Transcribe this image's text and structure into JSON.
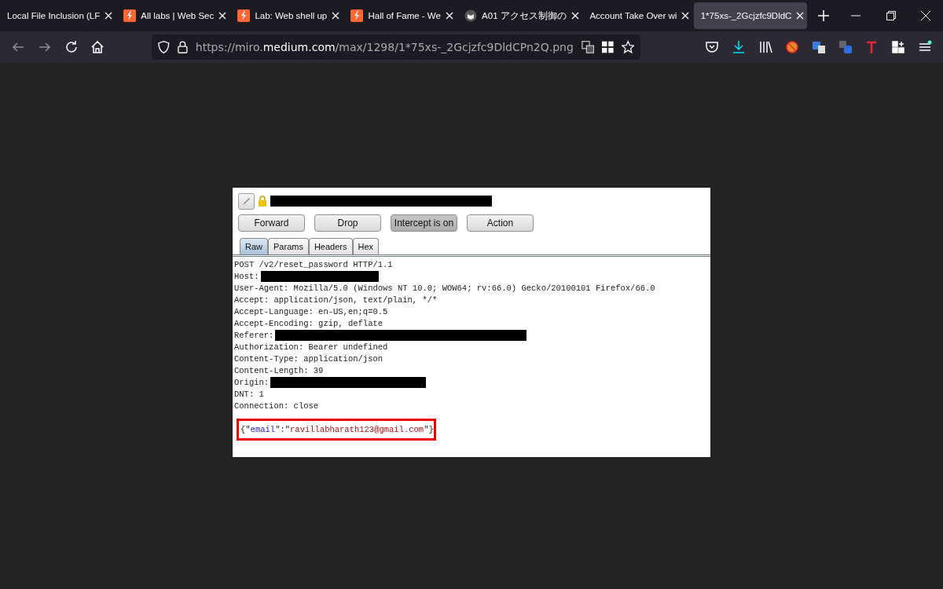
{
  "browser": {
    "tabs": [
      {
        "title": "Local File Inclusion (LF",
        "kind": "plain",
        "selected": false
      },
      {
        "title": "All labs | Web Sec",
        "kind": "bolt",
        "selected": false
      },
      {
        "title": "Lab: Web shell up",
        "kind": "bolt",
        "selected": false
      },
      {
        "title": "Hall of Fame - We",
        "kind": "bolt",
        "selected": false
      },
      {
        "title": "A01 アクセス制御の",
        "kind": "owl",
        "selected": false
      },
      {
        "title": "Account Take Over wi",
        "kind": "plain",
        "selected": false
      },
      {
        "title": "1*75xs-_2Gcjzfc9DldC",
        "kind": "plain",
        "selected": true
      }
    ],
    "url": {
      "before": "https://miro.",
      "domain": "medium.com",
      "after": "/max/1298/1*75xs-_2Gcjzfc9DldCPn2Q.png"
    }
  },
  "proxy": {
    "buttons": [
      {
        "label": "Forward",
        "pressed": false
      },
      {
        "label": "Drop",
        "pressed": false
      },
      {
        "label": "Intercept is on",
        "pressed": true
      },
      {
        "label": "Action",
        "pressed": false
      }
    ],
    "tabs": [
      {
        "label": "Raw",
        "selected": true
      },
      {
        "label": "Params",
        "selected": false
      },
      {
        "label": "Headers",
        "selected": false
      },
      {
        "label": "Hex",
        "selected": false
      }
    ],
    "request_lines": [
      {
        "text": "POST /v2/reset_password HTTP/1.1",
        "redacted": false
      },
      {
        "text": "Host:",
        "redacted": true
      },
      {
        "text": "User-Agent: Mozilla/5.0 (Windows NT 10.0; WOW64; rv:66.0) Gecko/20100101 Firefox/66.0",
        "redacted": false
      },
      {
        "text": "Accept: application/json, text/plain, */*",
        "redacted": false
      },
      {
        "text": "Accept-Language: en-US,en;q=0.5",
        "redacted": false
      },
      {
        "text": "Accept-Encoding: gzip, deflate",
        "redacted": false
      },
      {
        "text": "Referer:",
        "redacted": true
      },
      {
        "text": "Authorization: Bearer undefined",
        "redacted": false
      },
      {
        "text": "Content-Type: application/json",
        "redacted": false
      },
      {
        "text": "Content-Length: 39",
        "redacted": false
      },
      {
        "text": "Origin:",
        "redacted": true
      },
      {
        "text": "DNT: 1",
        "redacted": false
      },
      {
        "text": "Connection: close",
        "redacted": false
      }
    ],
    "body": [
      {
        "text": "{\"",
        "kind": "punct"
      },
      {
        "text": "email",
        "kind": "key"
      },
      {
        "text": "\":\"",
        "kind": "punct"
      },
      {
        "text": "ravillabharath123@gmail.com",
        "kind": "string"
      },
      {
        "text": "\"}",
        "kind": "punct"
      }
    ]
  }
}
